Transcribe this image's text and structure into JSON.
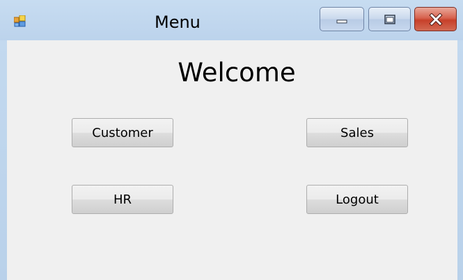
{
  "window": {
    "title": "Menu",
    "icon": "app-form-icon",
    "controls": {
      "minimize_icon": "minimize-icon",
      "maximize_icon": "maximize-icon",
      "close_icon": "close-icon"
    }
  },
  "form": {
    "heading": "Welcome",
    "buttons": {
      "customer": "Customer",
      "sales": "Sales",
      "hr": "HR",
      "logout": "Logout"
    }
  },
  "colors": {
    "titlebar": "#c7dcf1",
    "client_background": "#f0f0f0",
    "close_button": "#c7402a"
  }
}
